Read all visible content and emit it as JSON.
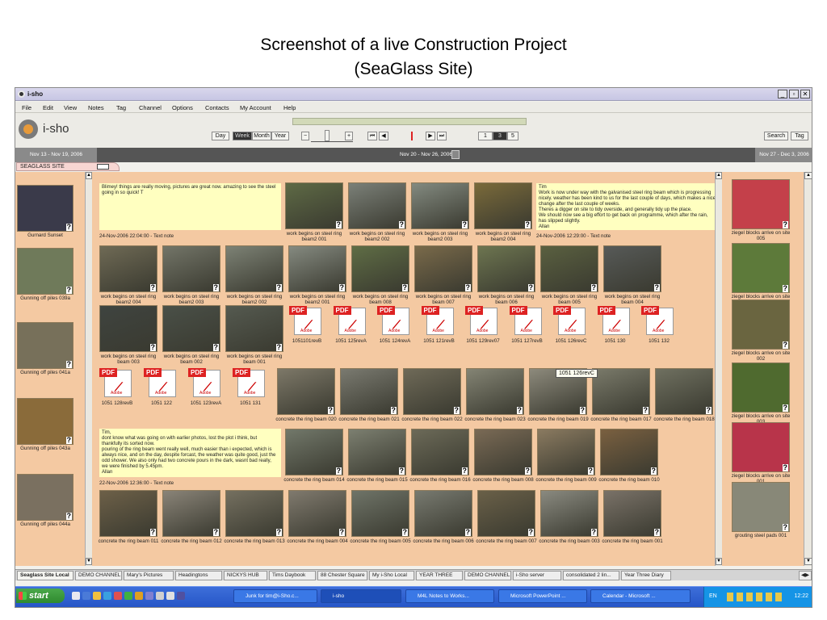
{
  "heading": {
    "line1": "Screenshot of a live Construction Project",
    "line2": "(SeaGlass Site)"
  },
  "window": {
    "title": "i-sho",
    "controls": [
      "_",
      "▫",
      "✕"
    ]
  },
  "menu": [
    "File",
    "Edit",
    "View",
    "Notes",
    "Tag",
    "Channel",
    "Options",
    "Contacts",
    "My Account",
    "Help"
  ],
  "toolbar": {
    "logo_text": "i-sho",
    "views": [
      "Day",
      "Week",
      "Month",
      "Year"
    ],
    "selected_view": "Week",
    "page_buttons": [
      "1",
      "3",
      "5"
    ],
    "search_label": "Search",
    "tag_label": "Tag"
  },
  "dates": {
    "prev": "Nov 13 - Nov 19, 2006",
    "current": "Nov 20 - Nov 26, 2006",
    "next": "Nov 27 - Dec 3, 2006"
  },
  "site_tab": "SEAGLASS SITE",
  "left_column": [
    {
      "caption": "Gurnard Sunset",
      "color": "#3a3a4a"
    },
    {
      "caption": "Gunning off piles 039a",
      "color": "#6f7a5a"
    },
    {
      "caption": "Gunning off piles 041a",
      "color": "#77705a"
    },
    {
      "caption": "Gunning off piles 043a",
      "color": "#8a6b3a"
    },
    {
      "caption": "Gunning off piles 044a",
      "color": "#7a7060"
    }
  ],
  "right_column": [
    {
      "caption": "ziegel blocks arrive on site 005",
      "color": "#c4404a"
    },
    {
      "caption": "ziegel blocks arrive on site 004",
      "color": "#5d7a3a"
    },
    {
      "caption": "ziegel blocks arrive on site 002",
      "color": "#6a6540"
    },
    {
      "caption": "ziegel blocks arrive on site 003",
      "color": "#4f6a2f"
    },
    {
      "caption": "ziegel blocks arrive on site 001",
      "color": "#b8344a"
    },
    {
      "caption": "grouting steel pads 001",
      "color": "#888878"
    }
  ],
  "notes": {
    "note1": "Blimey! things are really moving, pictures are great now. amazing to see the steel going in so quick! T",
    "note1_meta": "24-Nov-2006 22:04:00 - Text note",
    "note2": "Tim\nWork is now under way with the galvanised steel ring beam which is progressing nicely. weather has been kind to us for the last couple of days, which makes a nice change after the last couple of weeks.\nTheres a digger on site to tidy overside, and generally tidy up the place.\nWe should now see a big effort to get back on programme, which after the rain, has slipped slightly.\nAllan",
    "note2_meta": "24-Nov-2006 12:29:00 - Text note",
    "note3": "Tim,\ndont know what was going on with earlier photos, lost the plot i think, but thankfully its sorted now.\npouring of the ring beam went really well, much easier than i expected, which is always nice, and on the day, despite forcast, the weather was quite good, just the odd shower. We also only had two concrete pours in the dark, wasnt bad really, we were finished by 5.45pm.\nAllan",
    "note3_meta": "22-Nov-2006 12:36:00 - Text note"
  },
  "row1": [
    {
      "caption": "work begins on steel ring beam2 001",
      "color": "#5e6a45"
    },
    {
      "caption": "work begins on steel ring beam2 002",
      "color": "#7b8078"
    },
    {
      "caption": "work begins on steel ring beam2 003",
      "color": "#838a80"
    },
    {
      "caption": "work begins on steel ring beam2 004",
      "color": "#7a6a3a"
    }
  ],
  "row2": [
    {
      "caption": "work begins on steel ring beam2 004",
      "color": "#6f6a55"
    },
    {
      "caption": "work begins on steel ring beam2 003",
      "color": "#737568"
    },
    {
      "caption": "work begins on steel ring beam2 002",
      "color": "#7d8275"
    },
    {
      "caption": "work begins on steel ring beam2 001",
      "color": "#858a80"
    },
    {
      "caption": "work begins on steel ring beam 008",
      "color": "#5f6d45"
    },
    {
      "caption": "work begins on steel ring beam 007",
      "color": "#7a6a4a"
    },
    {
      "caption": "work begins on steel ring beam 006",
      "color": "#6d7550"
    },
    {
      "caption": "work begins on steel ring beam 005",
      "color": "#5a6040"
    },
    {
      "caption": "work begins on steel ring beam 004",
      "color": "#575a58"
    }
  ],
  "row3_photos": [
    {
      "caption": "work begins on steel ring beam 003",
      "color": "#3f4440"
    },
    {
      "caption": "work begins on steel ring beam 002",
      "color": "#4a5048"
    },
    {
      "caption": "work begins on steel ring beam 001",
      "color": "#555a50"
    }
  ],
  "row3_pdfs": [
    "1051101revB",
    "1051 125revA",
    "1051 124revA",
    "1051 121revB",
    "1051 129rev07",
    "1051 127revB",
    "1051 126revC",
    "1051 130",
    "1051 132"
  ],
  "row4_pdfs": [
    "1051 128revB",
    "1051 122",
    "1051 123revA",
    "1051 131"
  ],
  "row4_photos": [
    {
      "caption": "concrete the ring beam 020",
      "color": "#7d7868"
    },
    {
      "caption": "concrete the ring beam 021",
      "color": "#7a7a70"
    },
    {
      "caption": "concrete the ring beam 022",
      "color": "#6f6a58"
    },
    {
      "caption": "concrete the ring beam 023",
      "color": "#848474"
    },
    {
      "caption": "concrete the ring beam 019",
      "color": "#8d8a7c"
    },
    {
      "caption": "concrete the ring beam 017",
      "color": "#7a7a6a"
    },
    {
      "caption": "concrete the ring beam 018",
      "color": "#6f7060"
    }
  ],
  "tooltip": "1051 126revC",
  "row5": [
    {
      "caption": "concrete the ring beam 014",
      "color": "#72786a"
    },
    {
      "caption": "concrete the ring beam 015",
      "color": "#7c7f70"
    },
    {
      "caption": "concrete the ring beam 016",
      "color": "#6c6a58"
    },
    {
      "caption": "concrete the ring beam 008",
      "color": "#7a6a55"
    },
    {
      "caption": "concrete the ring beam 009",
      "color": "#8a7a60"
    },
    {
      "caption": "concrete the ring beam 010",
      "color": "#7a6040"
    }
  ],
  "row6": [
    {
      "caption": "concrete the ring beam 011",
      "color": "#6d6048"
    },
    {
      "caption": "concrete the ring beam 012",
      "color": "#8a8478"
    },
    {
      "caption": "concrete the ring beam 013",
      "color": "#757060"
    },
    {
      "caption": "concrete the ring beam 004",
      "color": "#807a6e"
    },
    {
      "caption": "concrete the ring beam 005",
      "color": "#6f7468"
    },
    {
      "caption": "concrete the ring beam 006",
      "color": "#787a70"
    },
    {
      "caption": "concrete the ring beam 007",
      "color": "#6a6048"
    },
    {
      "caption": "concrete the ring beam 003",
      "color": "#8a8a80"
    },
    {
      "caption": "concrete the ring beam 001",
      "color": "#7a7268"
    }
  ],
  "bottom_tabs": [
    "Seaglass Site Local",
    "DEMO CHANNEL",
    "Mary's Pictures",
    "Headingtons",
    "NICKYS HUB",
    "Tims Daybook",
    "88 Chester Square",
    "My i-Sho Local",
    "YEAR THREE",
    "DEMO CHANNEL",
    "i-Sho server",
    "consolidated 2 lin...",
    "Year Three Diary"
  ],
  "taskbar": {
    "start": "start",
    "tasks": [
      "Junk for tim@i-Sho.c...",
      "i-sho",
      "M4L Notes to Works...",
      "Microsoft PowerPoint ...",
      "Calendar - Microsoft ..."
    ],
    "lang": "EN",
    "clock": "12:22"
  }
}
